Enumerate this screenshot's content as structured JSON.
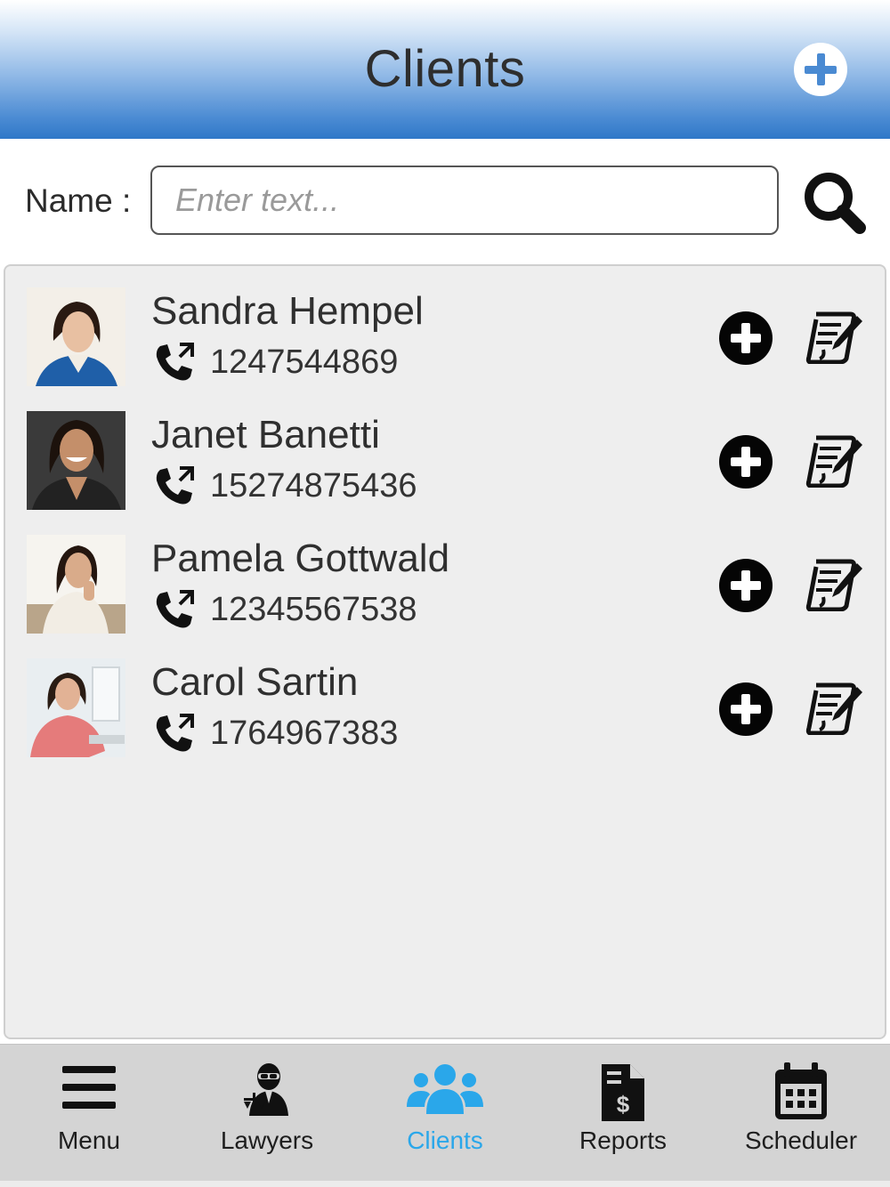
{
  "header": {
    "title": "Clients",
    "add_icon": "plus-circle-icon",
    "accent_color": "#2f78c8"
  },
  "search": {
    "label": "Name :",
    "placeholder": "Enter text...",
    "value": "",
    "icon": "magnifier-icon"
  },
  "clients": [
    {
      "name": "Sandra Hempel",
      "phone": "1247544869",
      "photo_bg": "#f3efe8",
      "hair": "#2a1a12",
      "skin": "#e8c0a2",
      "top": "#1f5fa8"
    },
    {
      "name": "Janet Banetti",
      "phone": "15274875436",
      "photo_bg": "#3a3a3a",
      "hair": "#1c120c",
      "skin": "#c48f6a",
      "top": "#222222"
    },
    {
      "name": "Pamela Gottwald",
      "phone": "12345567538",
      "photo_bg": "#f6f4ef",
      "hair": "#24160f",
      "skin": "#d9ab8a",
      "top": "#f2ede4"
    },
    {
      "name": "Carol Sartin",
      "phone": "1764967383",
      "photo_bg": "#e9eef1",
      "hair": "#2a1c14",
      "skin": "#e2b295",
      "top": "#e57b7b"
    }
  ],
  "row_icons": {
    "phone": "phone-call-icon",
    "add": "plus-circle-icon",
    "edit": "edit-note-icon"
  },
  "nav": {
    "items": [
      {
        "label": "Menu",
        "icon": "hamburger-icon"
      },
      {
        "label": "Lawyers",
        "icon": "lawyer-icon"
      },
      {
        "label": "Clients",
        "icon": "group-icon",
        "active": true
      },
      {
        "label": "Reports",
        "icon": "invoice-icon"
      },
      {
        "label": "Scheduler",
        "icon": "calendar-icon"
      }
    ],
    "active_color": "#2aa7ea"
  }
}
